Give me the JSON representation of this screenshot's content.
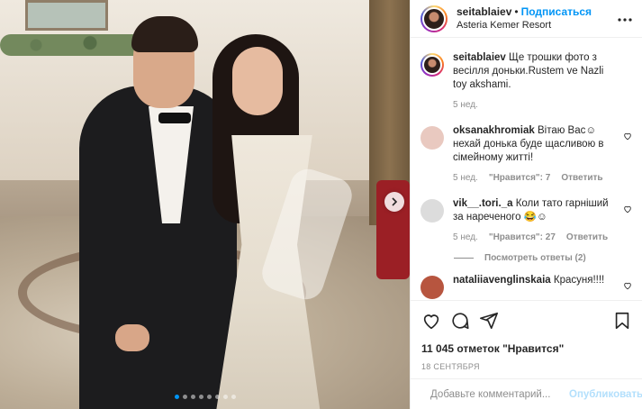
{
  "post": {
    "username": "seitablaiev",
    "separator": "•",
    "follow_label": "Подписаться",
    "location": "Asteria Kemer Resort",
    "more_icon": "more-dots-icon",
    "carousel": {
      "dot_count": 8,
      "active_index": 0
    }
  },
  "caption": {
    "username": "seitablaiev",
    "text": "Ще трошки фото з весілля доньки.Rustem ve Nazli toy akshami.",
    "time": "5 нед."
  },
  "comments": [
    {
      "username": "oksanakhromiak",
      "text": "Вітаю Вас☺ нехай донька буде щасливою в сімейному житті!",
      "time": "5 нед.",
      "likes": "\"Нравится\": 7",
      "reply": "Ответить",
      "avatar_color": "#e9c9c0"
    },
    {
      "username": "vik__.tori._a",
      "text": "Коли тато гарніший за нареченого 😂☺",
      "time": "5 нед.",
      "likes": "\"Нравится\": 27",
      "reply": "Ответить",
      "avatar_color": "#dcdcdc",
      "view_replies": "Посмотреть ответы (2)"
    },
    {
      "username": "nataliiavenglinskaia",
      "text": "Красуня!!!!",
      "avatar_color": "#b7553f"
    }
  ],
  "actions": {
    "icons": [
      "heart-icon",
      "comment-icon",
      "share-icon",
      "bookmark-icon"
    ],
    "likes_total": "11 045 отметок \"Нравится\"",
    "date": "18 СЕНТЯБРЯ"
  },
  "add_comment": {
    "placeholder": "Добавьте комментарий...",
    "publish_label": "Опубликовать"
  },
  "colors": {
    "accent": "#0095f6",
    "publish_disabled": "#b2dffc",
    "secondary_text": "#8e8e8e"
  }
}
